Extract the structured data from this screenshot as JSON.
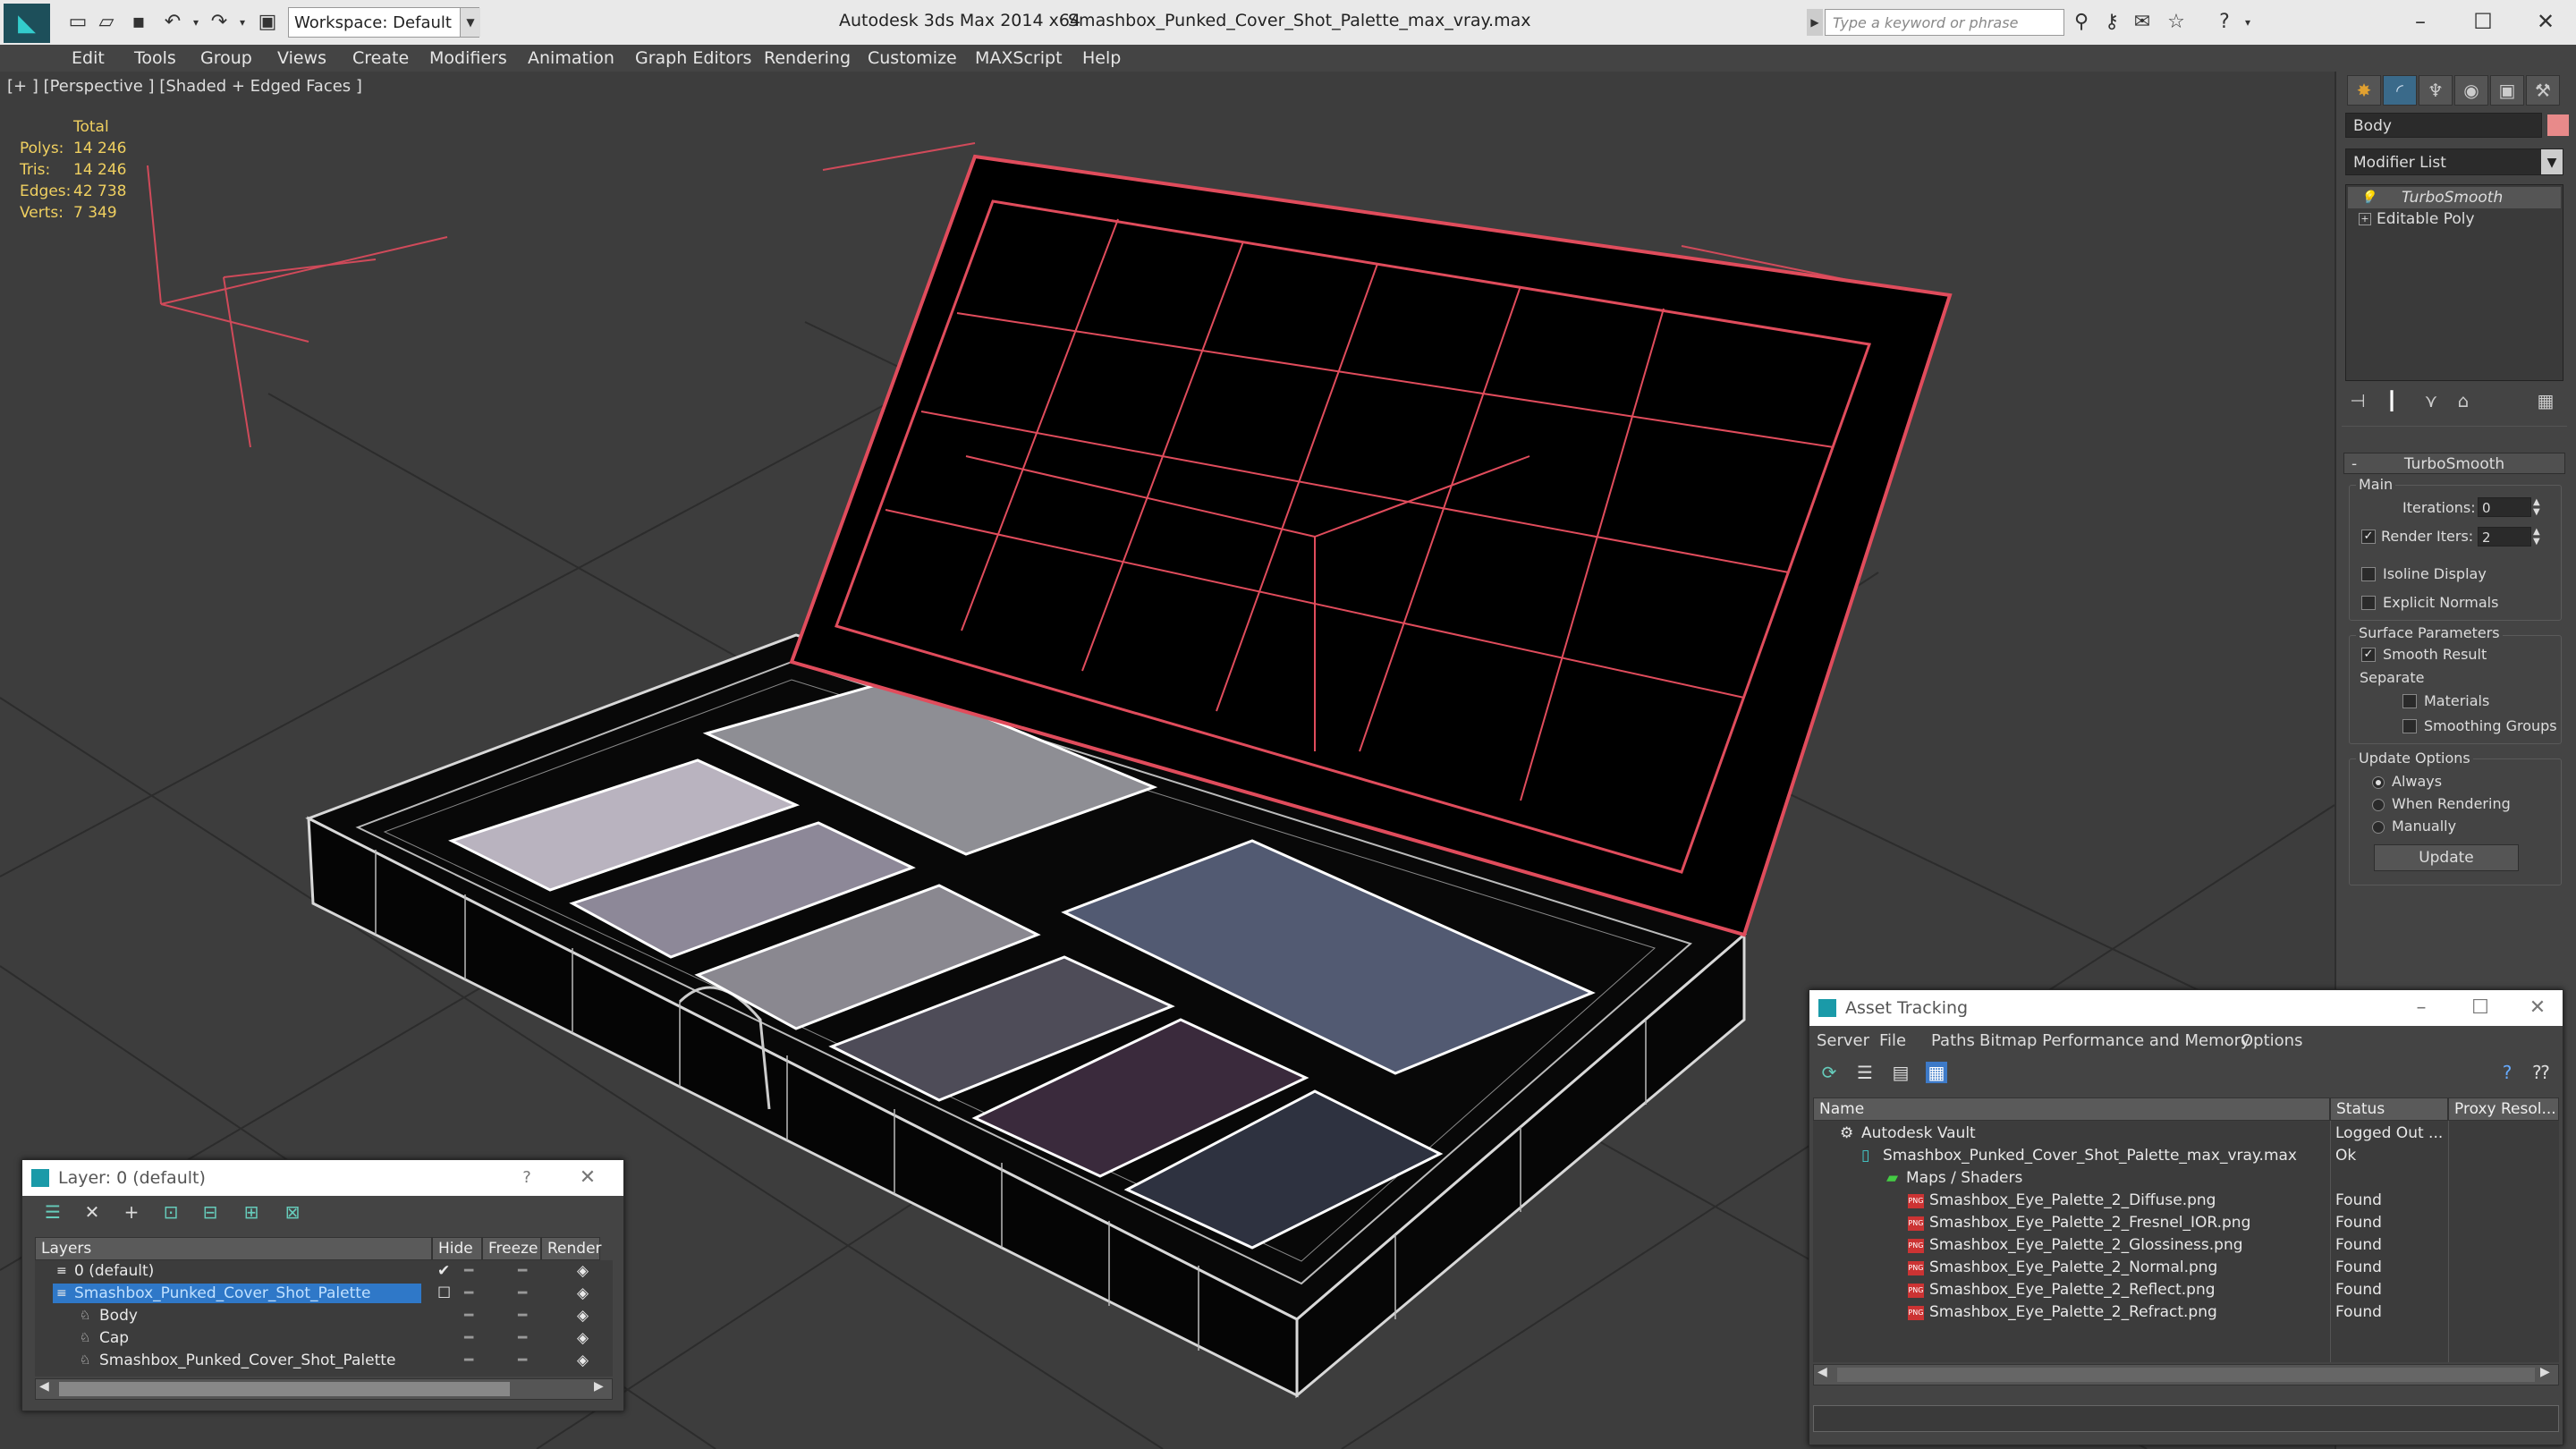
{
  "titlebar": {
    "app_title": "Autodesk 3ds Max  2014 x64",
    "file_title": "Smashbox_Punked_Cover_Shot_Palette_max_vray.max",
    "workspace": "Workspace: Default",
    "search_placeholder": "Type a keyword or phrase"
  },
  "menubar": [
    "Edit",
    "Tools",
    "Group",
    "Views",
    "Create",
    "Modifiers",
    "Animation",
    "Graph Editors",
    "Rendering",
    "Customize",
    "MAXScript",
    "Help"
  ],
  "viewport": {
    "label": "[+ ] [Perspective ] [Shaded + Edged Faces ]",
    "stats": {
      "header": "Total",
      "rows": [
        {
          "key": "Polys:",
          "value": "14 246"
        },
        {
          "key": "Tris:",
          "value": "14 246"
        },
        {
          "key": "Edges:",
          "value": "42 738"
        },
        {
          "key": "Verts:",
          "value": "7 349"
        }
      ]
    }
  },
  "command_panel": {
    "object_name": "Body",
    "object_color": "#e88a8a",
    "modifier_list": "Modifier List",
    "stack": [
      "TurboSmooth",
      "Editable Poly"
    ],
    "rollout": "TurboSmooth",
    "main_group": "Main",
    "iterations_label": "Iterations:",
    "iterations_value": "0",
    "render_iters_label": "Render Iters:",
    "render_iters_value": "2",
    "isoline": "Isoline Display",
    "explicit_normals": "Explicit Normals",
    "surface_group": "Surface Parameters",
    "smooth_result": "Smooth Result",
    "separate": "Separate",
    "materials": "Materials",
    "smoothing_groups": "Smoothing Groups",
    "update_group": "Update Options",
    "always": "Always",
    "when_rendering": "When Rendering",
    "manually": "Manually",
    "update_btn": "Update"
  },
  "layer_panel": {
    "title": "Layer: 0 (default)",
    "help": "?",
    "columns": [
      "Layers",
      "Hide",
      "Freeze",
      "Render"
    ],
    "rows": [
      {
        "name": "0 (default)",
        "indent": 0
      },
      {
        "name": "Smashbox_Punked_Cover_Shot_Palette",
        "indent": 0,
        "selected": true
      },
      {
        "name": "Body",
        "indent": 1
      },
      {
        "name": "Cap",
        "indent": 1
      },
      {
        "name": "Smashbox_Punked_Cover_Shot_Palette",
        "indent": 1
      }
    ]
  },
  "asset_panel": {
    "title": "Asset Tracking",
    "menu": [
      "Server",
      "File",
      "Paths",
      "Bitmap Performance and Memory",
      "Options"
    ],
    "columns": [
      "Name",
      "Status",
      "Proxy Resol..."
    ],
    "rows": [
      {
        "name": "Autodesk Vault",
        "status": "Logged Out ...",
        "indent": 0
      },
      {
        "name": "Smashbox_Punked_Cover_Shot_Palette_max_vray.max",
        "status": "Ok",
        "indent": 1
      },
      {
        "name": "Maps / Shaders",
        "status": "",
        "indent": 2
      },
      {
        "name": "Smashbox_Eye_Palette_2_Diffuse.png",
        "status": "Found",
        "indent": 3
      },
      {
        "name": "Smashbox_Eye_Palette_2_Fresnel_IOR.png",
        "status": "Found",
        "indent": 3
      },
      {
        "name": "Smashbox_Eye_Palette_2_Glossiness.png",
        "status": "Found",
        "indent": 3
      },
      {
        "name": "Smashbox_Eye_Palette_2_Normal.png",
        "status": "Found",
        "indent": 3
      },
      {
        "name": "Smashbox_Eye_Palette_2_Reflect.png",
        "status": "Found",
        "indent": 3
      },
      {
        "name": "Smashbox_Eye_Palette_2_Refract.png",
        "status": "Found",
        "indent": 3
      }
    ]
  }
}
